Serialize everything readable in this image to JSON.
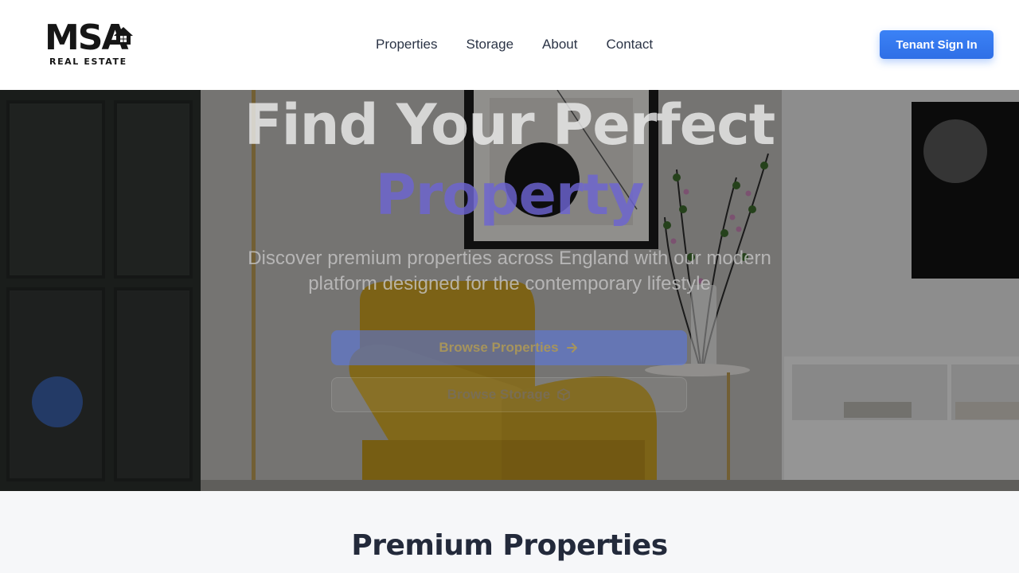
{
  "brand": {
    "name": "MSA",
    "subtitle": "REAL ESTATE"
  },
  "nav": {
    "items": [
      "Properties",
      "Storage",
      "About",
      "Contact"
    ]
  },
  "header": {
    "signin_label": "Tenant Sign In"
  },
  "hero": {
    "title_line1": "Find Your Perfect",
    "title_line2": "Property",
    "subtitle": "Discover premium properties across England with our modern platform designed for the contemporary lifestyle",
    "primary_button": "Browse Properties",
    "secondary_button": "Browse Storage"
  },
  "section": {
    "title": "Premium Properties"
  },
  "colors": {
    "accent": "#3b82f6",
    "brand_dark": "#161616",
    "hero_highlight": "#6c64d2"
  },
  "icons": {
    "primary_button": "arrow-right-icon",
    "secondary_button": "box-icon",
    "logo": "house-icon"
  }
}
